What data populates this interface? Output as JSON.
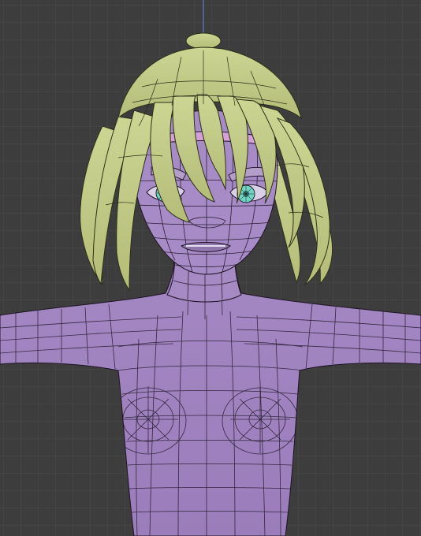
{
  "viewport": {
    "mode": "3d-viewport-wireframe-overlay",
    "background_color": "#3d3d3d",
    "grid_color": "#4a4a4a",
    "axis_color": "#5a7fd0"
  },
  "model": {
    "skin_color": "#a98ac7",
    "skin_shadow_color": "#8f72b0",
    "hair_color": "#c7cf8a",
    "hair_shadow_color": "#9aa265",
    "eye_color": "#6fd6c4",
    "wire_color": "#1e1424"
  }
}
